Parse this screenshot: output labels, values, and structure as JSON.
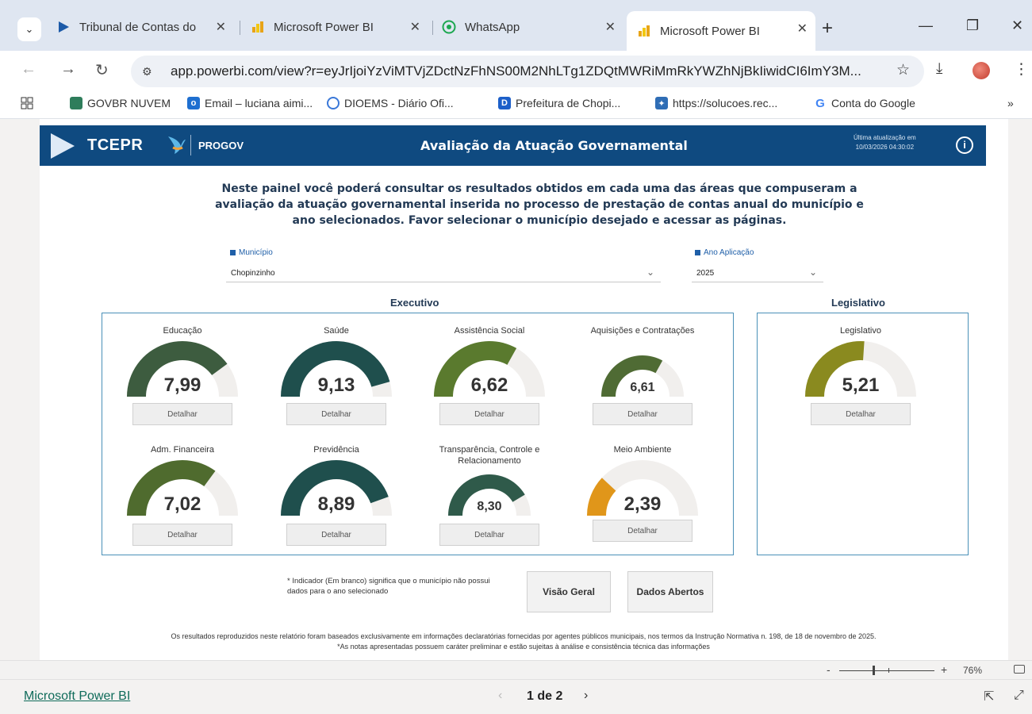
{
  "browser": {
    "tabs": [
      {
        "title": "Tribunal de Contas do",
        "icon": "tce-icon"
      },
      {
        "title": "Microsoft Power BI",
        "icon": "powerbi-icon"
      },
      {
        "title": "WhatsApp",
        "icon": "whatsapp-icon"
      },
      {
        "title": "Microsoft Power BI",
        "icon": "powerbi-icon"
      }
    ],
    "url": "app.powerbi.com/view?r=eyJrIjoiYzViMTVjZDctNzFhNS00M2NhLTg1ZDQtMWRiMmRkYWZhNjBkIiwidCI6ImY3M...",
    "bookmarks": [
      {
        "label": "GOVBR NUVEM"
      },
      {
        "label": "Email – luciana aimi..."
      },
      {
        "label": "DIOEMS - Diário Ofi..."
      },
      {
        "label": "Prefeitura de Chopi..."
      },
      {
        "label": "https://solucoes.rec..."
      },
      {
        "label": "Conta do Google"
      }
    ]
  },
  "report": {
    "brand": "TCEPR",
    "brand2": "PROGOV",
    "title": "Avaliação da Atuação Governamental",
    "updated_label": "Última atualização em",
    "updated_value": "10/03/2026 04:30:02",
    "intro": "Neste painel você poderá consultar os resultados obtidos em cada uma das áreas que compuseram a avaliação da atuação governamental inserida no processo de prestação de contas anual do município e ano selecionados. Favor selecionar o município desejado e acessar as páginas.",
    "municipio_label": "Município",
    "municipio_value": "Chopinzinho",
    "ano_label": "Ano Aplicação",
    "ano_value": "2025",
    "executivo_title": "Executivo",
    "legislativo_title": "Legislativo",
    "detail_label": "Detalhar",
    "gauges": [
      {
        "title": "Educação",
        "value": "7,99",
        "score": 7.99,
        "color": "#3d5c3f"
      },
      {
        "title": "Saúde",
        "value": "9,13",
        "score": 9.13,
        "color": "#1f4f4d"
      },
      {
        "title": "Assistência Social",
        "value": "6,62",
        "score": 6.62,
        "color": "#5a7a2e"
      },
      {
        "title": "Aquisições e Contratações",
        "value": "6,61",
        "score": 6.61,
        "color": "#4f6b34"
      },
      {
        "title": "Adm. Financeira",
        "value": "7,02",
        "score": 7.02,
        "color": "#4f6b2e"
      },
      {
        "title": "Previdência",
        "value": "8,89",
        "score": 8.89,
        "color": "#1f4f4d"
      },
      {
        "title": "Transparência, Controle e Relacionamento",
        "value": "8,30",
        "score": 8.3,
        "color": "#2f5a4a"
      },
      {
        "title": "Meio Ambiente",
        "value": "2,39",
        "score": 2.39,
        "color": "#e0961a"
      },
      {
        "title": "Legislativo",
        "value": "5,21",
        "score": 5.21,
        "color": "#8a8a1f"
      }
    ],
    "note": "* Indicador (Em branco) significa que o município não possui dados para o ano selecionado",
    "visao_geral": "Visão Geral",
    "dados_abertos": "Dados Abertos",
    "footer1": "Os resultados reproduzidos neste relatório foram baseados exclusivamente em informações declaratórias fornecidas por agentes públicos municipais, nos termos da Instrução Normativa n. 198, de 18 de novembro de 2025.",
    "footer2": "*As notas apresentadas possuem caráter preliminar e estão sujeitas à análise e consistência técnica das informações"
  },
  "zoom": {
    "minus": "-",
    "plus": "+",
    "percent": "76%"
  },
  "bottom": {
    "app_name": "Microsoft Power BI",
    "page": "1 de 2"
  }
}
